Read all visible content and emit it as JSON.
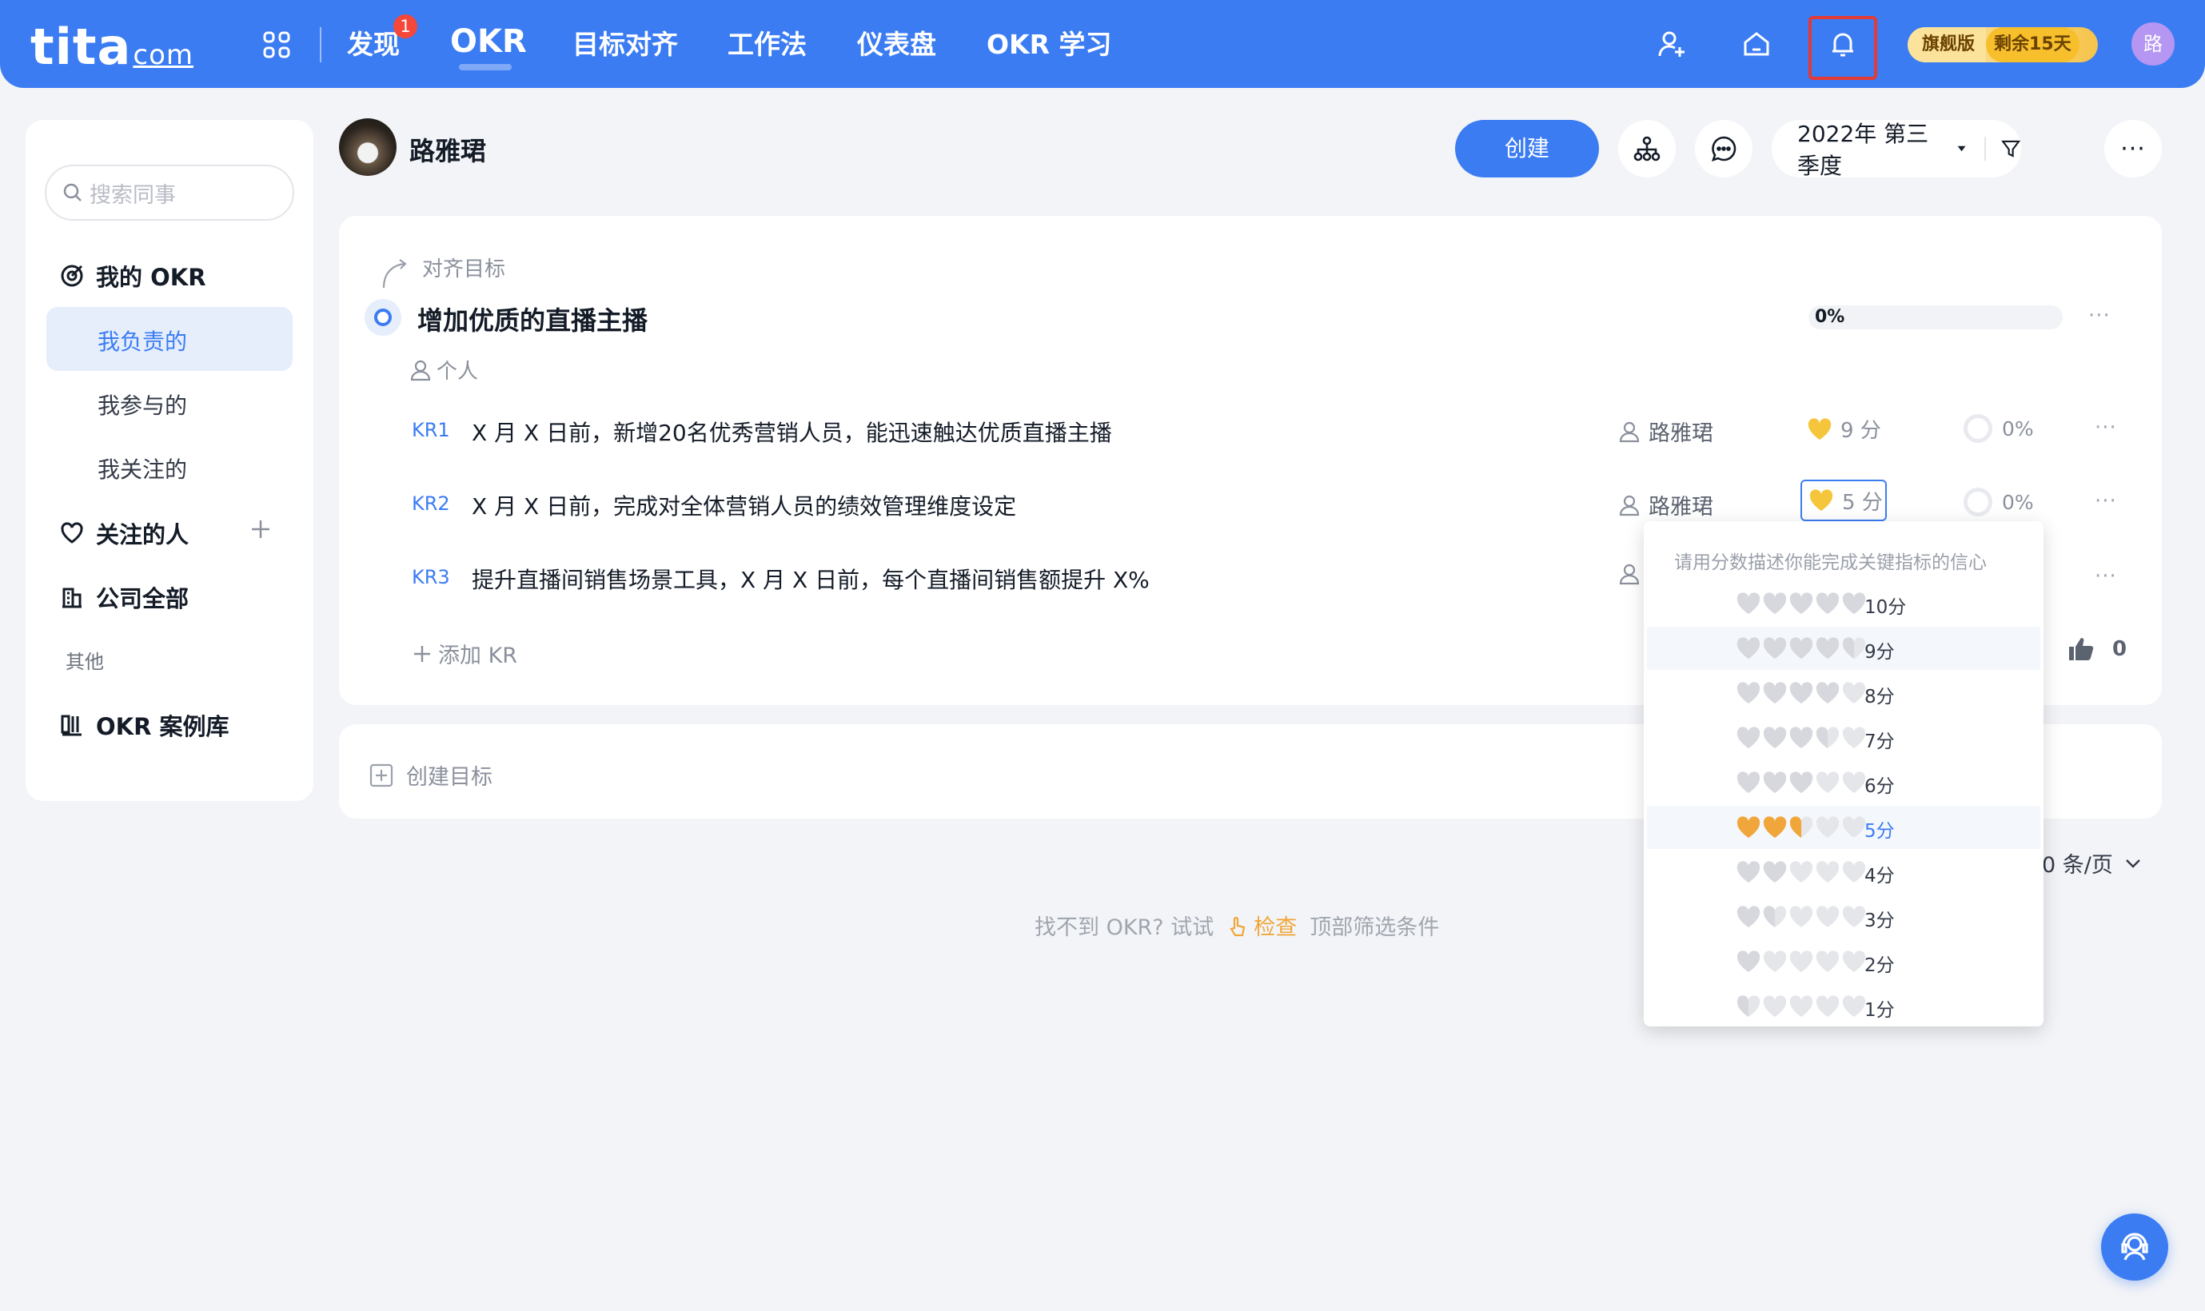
{
  "topbar": {
    "logo_main": "tita",
    "logo_suffix": "com",
    "nav": [
      {
        "label": "发现",
        "badge": "1"
      },
      {
        "label": "OKR"
      },
      {
        "label": "目标对齐"
      },
      {
        "label": "工作法"
      },
      {
        "label": "仪表盘"
      },
      {
        "label": "OKR 学习"
      }
    ],
    "plan_label": "旗舰版",
    "plan_remaining": "剩余15天",
    "avatar_text": "路",
    "colors": {
      "bar": "#3b7cf3",
      "badge": "#f5483b",
      "highlight_box": "#e53935"
    }
  },
  "sidebar": {
    "search_placeholder": "搜索同事",
    "my_okr": "我的 OKR",
    "my_okr_items": [
      "我负责的",
      "我参与的",
      "我关注的"
    ],
    "followed_people": "关注的人",
    "company_all": "公司全部",
    "other_section": "其他",
    "okr_cases": "OKR 案例库"
  },
  "header": {
    "user_name": "路雅珺",
    "create_button": "创建",
    "period": "2022年 第三季度"
  },
  "objective": {
    "align_label": "对齐目标",
    "title": "增加优质的直播主播",
    "progress": "0%",
    "progress_value": 0,
    "type_label": "个人",
    "key_results": [
      {
        "tag": "KR1",
        "text": "X 月 X 日前，新增20名优秀营销人员，能迅速触达优质直播主播",
        "owner": "路雅珺",
        "score": "9 分",
        "progress": "0%"
      },
      {
        "tag": "KR2",
        "text": "X 月 X 日前，完成对全体营销人员的绩效管理维度设定",
        "owner": "路雅珺",
        "score": "5 分",
        "progress": "0%"
      },
      {
        "tag": "KR3",
        "text": "提升直播间销售场景工具，X 月 X 日前，每个直播间销售额提升 X%",
        "owner": "",
        "score": "",
        "progress": ""
      }
    ],
    "add_kr": "添加 KR",
    "likes": "0"
  },
  "create_objective": "创建目标",
  "pagination": {
    "per_page": "0 条/页"
  },
  "hint": {
    "prefix": "找不到 OKR? 试试",
    "link": "检查",
    "suffix": "顶部筛选条件"
  },
  "confidence_dropdown": {
    "title": "请用分数描述你能完成关键指标的信心",
    "options": [
      {
        "label": "10分",
        "value": 10
      },
      {
        "label": "9分",
        "value": 9
      },
      {
        "label": "8分",
        "value": 8
      },
      {
        "label": "7分",
        "value": 7
      },
      {
        "label": "6分",
        "value": 6
      },
      {
        "label": "5分",
        "value": 5
      },
      {
        "label": "4分",
        "value": 4
      },
      {
        "label": "3分",
        "value": 3
      },
      {
        "label": "2分",
        "value": 2
      },
      {
        "label": "1分",
        "value": 1
      }
    ],
    "hovered": "9分",
    "selected": "5分",
    "colors": {
      "filled": "#f0a63a",
      "empty": "#e4e6ea",
      "selected_text": "#3b7cf3"
    }
  }
}
